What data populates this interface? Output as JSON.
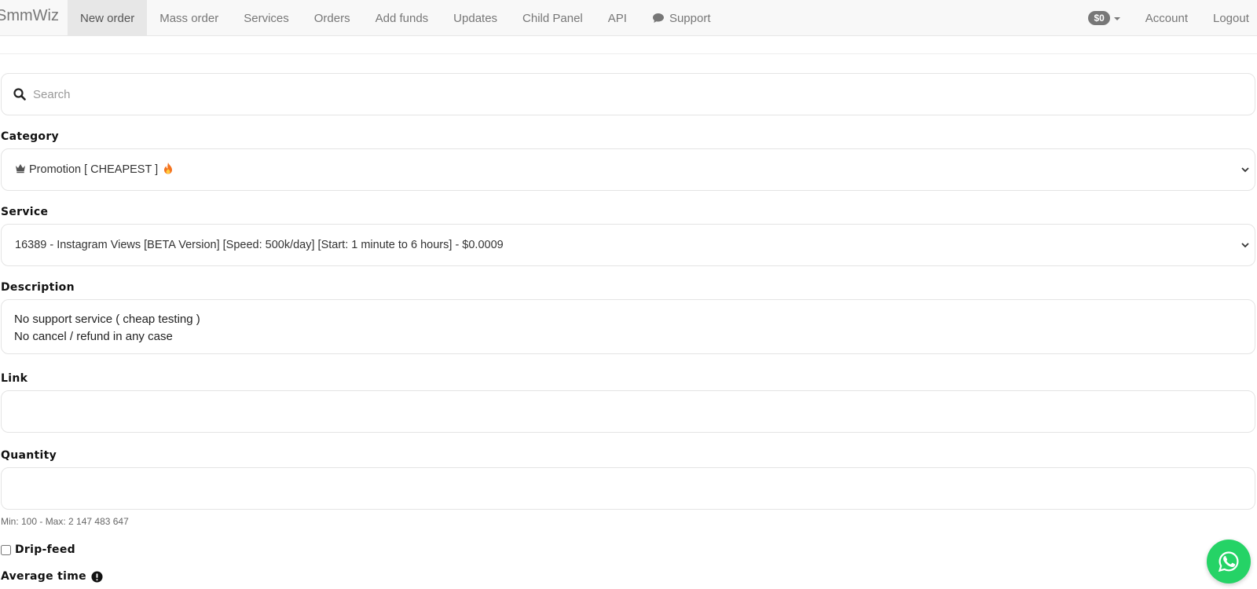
{
  "brand": "SmmWiz",
  "nav": {
    "items": [
      {
        "label": "New order"
      },
      {
        "label": "Mass order"
      },
      {
        "label": "Services"
      },
      {
        "label": "Orders"
      },
      {
        "label": "Add funds"
      },
      {
        "label": "Updates"
      },
      {
        "label": "Child Panel"
      },
      {
        "label": "API"
      },
      {
        "label": "Support",
        "icon": "chat-icon"
      }
    ],
    "active": "New order",
    "balance": "$0",
    "account": "Account",
    "logout": "Logout"
  },
  "search": {
    "placeholder": "Search",
    "icon": "search-icon"
  },
  "form": {
    "category_label": "Category",
    "category_value": "Promotion [ CHEAPEST ]",
    "category_icons": [
      "crown-icon",
      "fire-icon"
    ],
    "service_label": "Service",
    "service_value": "16389 - Instagram Views [BETA Version] [Speed: 500k/day] [Start: 1 minute to 6 hours] - $0.0009",
    "description_label": "Description",
    "description_lines": [
      "No support service ( cheap testing )",
      "No cancel / refund in any case"
    ],
    "link_label": "Link",
    "link_value": "",
    "quantity_label": "Quantity",
    "quantity_value": "",
    "quantity_help": "Min: 100 - Max: 2 147 483 647",
    "dripfeed_label": "Drip-feed",
    "average_time_label": "Average time"
  },
  "colors": {
    "navbar_bg": "#f8f8f8",
    "active_tab_bg": "#e7e7e7",
    "badge_bg": "#777777",
    "whatsapp": "#25d366"
  }
}
